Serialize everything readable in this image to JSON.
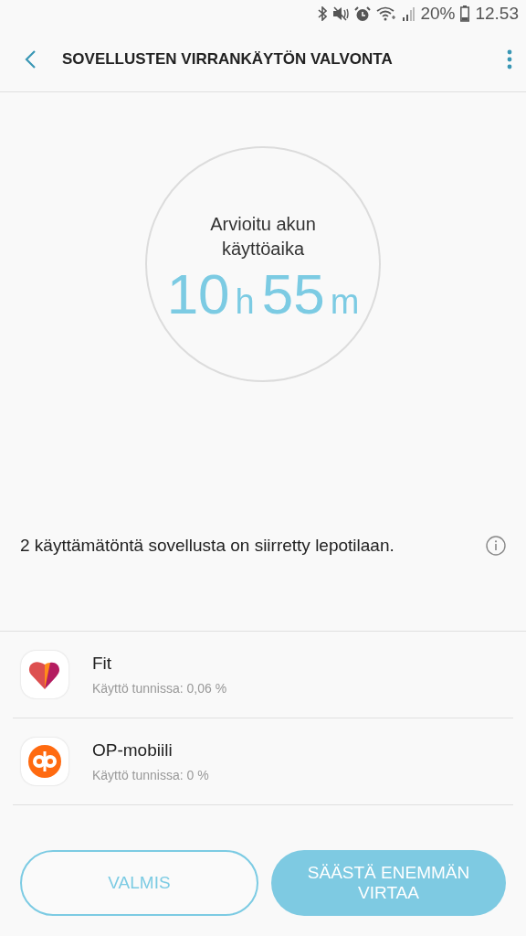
{
  "status_bar": {
    "battery": "20%",
    "time": "12.53"
  },
  "app_bar": {
    "title": "SOVELLUSTEN VIRRANKÄYTÖN VALVONTA"
  },
  "gauge": {
    "label": "Arvioitu akun käyttöaika",
    "hours": "10",
    "hours_unit": "h",
    "minutes": "55",
    "minutes_unit": "m"
  },
  "notice": {
    "text": "2 käyttämätöntä sovellusta on siirretty lepotilaan."
  },
  "apps": [
    {
      "name": "Fit",
      "usage": "Käyttö tunnissa: 0,06 %",
      "kind": "heart"
    },
    {
      "name": "OP-mobiili",
      "usage": "Käyttö tunnissa: 0 %",
      "kind": "op"
    }
  ],
  "buttons": [
    {
      "label": "VALMIS",
      "kind": "outline"
    },
    {
      "label": "SÄÄSTÄ ENEMMÄN VIRTAA",
      "kind": "filled"
    }
  ]
}
